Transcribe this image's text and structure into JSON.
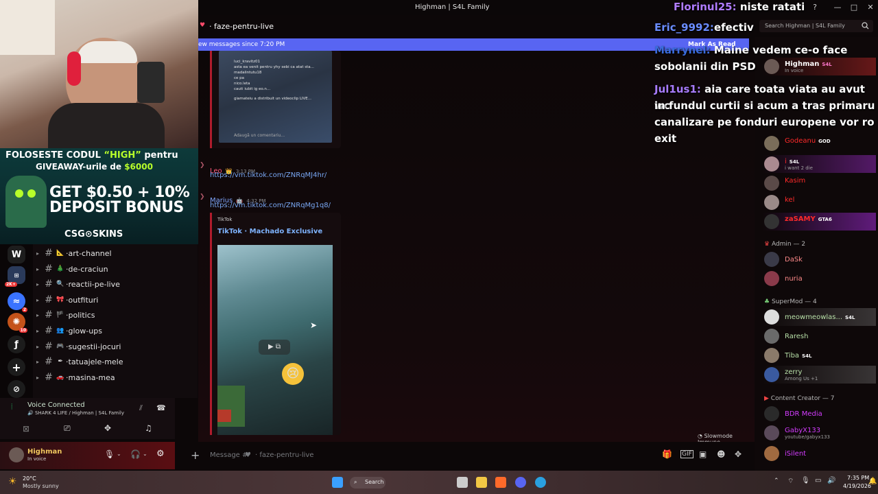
{
  "window": {
    "title": "Highman | S4L Family"
  },
  "channel_header": {
    "name": "faze-pentru-live",
    "search_placeholder": "Search Highman | S4L Family"
  },
  "new_messages": {
    "text": "ew messages since 7:20 PM",
    "mark_as_read": "Mark As Read"
  },
  "embed1": {
    "comment_prompt": "Adaugă un comentariu...",
    "lines": [
      "luci_kravitz01",
      "asta ea venit pentru yhy sebi ca atat sta...",
      "madalintutu18",
      "ce pa",
      "nico.leta",
      "cauti iubit ig eo.n...",
      "giamateiu a distribuit un videoclip LIVE..."
    ]
  },
  "messages": [
    {
      "author": "Leo",
      "time": "3:13 PM",
      "link": "https://vm.tiktok.com/ZNRqMJ4hr/"
    },
    {
      "author": "Marius",
      "time": "4:32 PM",
      "link": "https://vm.tiktok.com/ZNRqMg1q8/"
    }
  ],
  "embed2": {
    "provider": "TikTok",
    "title": "TikTok · Machado Exclusive"
  },
  "slowmode": "Slowmode Immune",
  "composer": {
    "prefix": "Message #",
    "channel": "· faze-pentru-live"
  },
  "channels": [
    {
      "name": "art-channel",
      "emoji": "📐"
    },
    {
      "name": "de-craciun",
      "emoji": "🎄"
    },
    {
      "name": "reactii-pe-live",
      "emoji": "🔍"
    },
    {
      "name": "outfituri",
      "emoji": "🎀"
    },
    {
      "name": "politics",
      "emoji": "🏴"
    },
    {
      "name": "glow-ups",
      "emoji": "👥"
    },
    {
      "name": "sugestii-jocuri",
      "emoji": "🎮"
    },
    {
      "name": "tatuajele-mele",
      "emoji": "✒"
    },
    {
      "name": "masina-mea",
      "emoji": "🚗"
    }
  ],
  "server_badges": {
    "srv3": "2K+",
    "srv4": "2",
    "srv5": "10"
  },
  "voice": {
    "status": "Voice Connected",
    "location": "SHARK 4 LIFE / Highman | S4L Family"
  },
  "user": {
    "name": "Highman",
    "status": "In voice"
  },
  "promo": {
    "line1_a": "FOLOSESTE CODUL ",
    "line1_code": "“HIGH”",
    "line1_b": " pentru",
    "line2_a": "GIVEAWAY-urile de ",
    "line2_amount": "$6000",
    "big1": "GET $0.50 + 10%",
    "big2": "DEPOSIT BONUS",
    "brand": "CSG⊙SKINS"
  },
  "stream_chat": [
    {
      "user": "Florinul25:",
      "text": "niste ratati"
    },
    {
      "user": "Eric_9992:",
      "text": "efectiv"
    },
    {
      "user": "Marrynel:",
      "text": "Maine vedem ce-o face"
    },
    {
      "text": "sobolanii din PSD"
    },
    {
      "user": "Jul1us1:",
      "text": "aia care toata viata au avut wc"
    },
    {
      "text": "in fundul curtii si acum a tras primaru"
    },
    {
      "text": "canalizare pe fonduri europene vor ro"
    },
    {
      "text": "exit"
    }
  ],
  "members": {
    "top": [
      {
        "name": "Highman",
        "tag": "S4L",
        "sub": "In voice",
        "color": "#ffffff"
      },
      {
        "name": "Godeanu",
        "tag": "GOD",
        "sub": "",
        "color": "#ff2a2a"
      },
      {
        "name": "i",
        "tag": "S4L",
        "sub": "i want 2 die",
        "color": "#ff2a2a"
      },
      {
        "name": "Kasim",
        "tag": "",
        "sub": "",
        "color": "#ff2a2a"
      },
      {
        "name": "kel",
        "tag": "",
        "sub": "",
        "color": "#ff2a2a"
      },
      {
        "name": "zaSAMY",
        "tag": "GTA6",
        "sub": "",
        "color": "#ff2a2a"
      }
    ],
    "admin_header": "Admin — 2",
    "admin": [
      {
        "name": "DaSk",
        "color": "#ff8a8a"
      },
      {
        "name": "nuria",
        "color": "#ff8a8a"
      }
    ],
    "supermod_header": "SuperMod — 4",
    "supermod": [
      {
        "name": "meowmeowlas...",
        "tag": "S4L",
        "sub": "",
        "color": "#b8e0a8"
      },
      {
        "name": "Raresh",
        "tag": "",
        "sub": "",
        "color": "#b8e0a8"
      },
      {
        "name": "Tiba",
        "tag": "S4L",
        "sub": "",
        "color": "#b8e0a8"
      },
      {
        "name": "zerry",
        "tag": "",
        "sub": "Among Us +1",
        "color": "#b8e0a8"
      }
    ],
    "cc_header": "Content Creator — 7",
    "cc": [
      {
        "name": "BDR Media",
        "sub": "",
        "color": "#d43cff"
      },
      {
        "name": "GabyX133",
        "sub": "youtube/gabyx133",
        "color": "#d43cff"
      },
      {
        "name": "iSilent",
        "sub": "",
        "color": "#d43cff"
      }
    ]
  },
  "taskbar": {
    "weather_temp": "20°C",
    "weather_text": "Mostly sunny",
    "search": "Search",
    "time": "7:35 PM",
    "date": "4/19/2026"
  },
  "colors": {
    "accent": "#5865f2",
    "bg": "#0c0708",
    "danger": "#ff2a2a"
  }
}
